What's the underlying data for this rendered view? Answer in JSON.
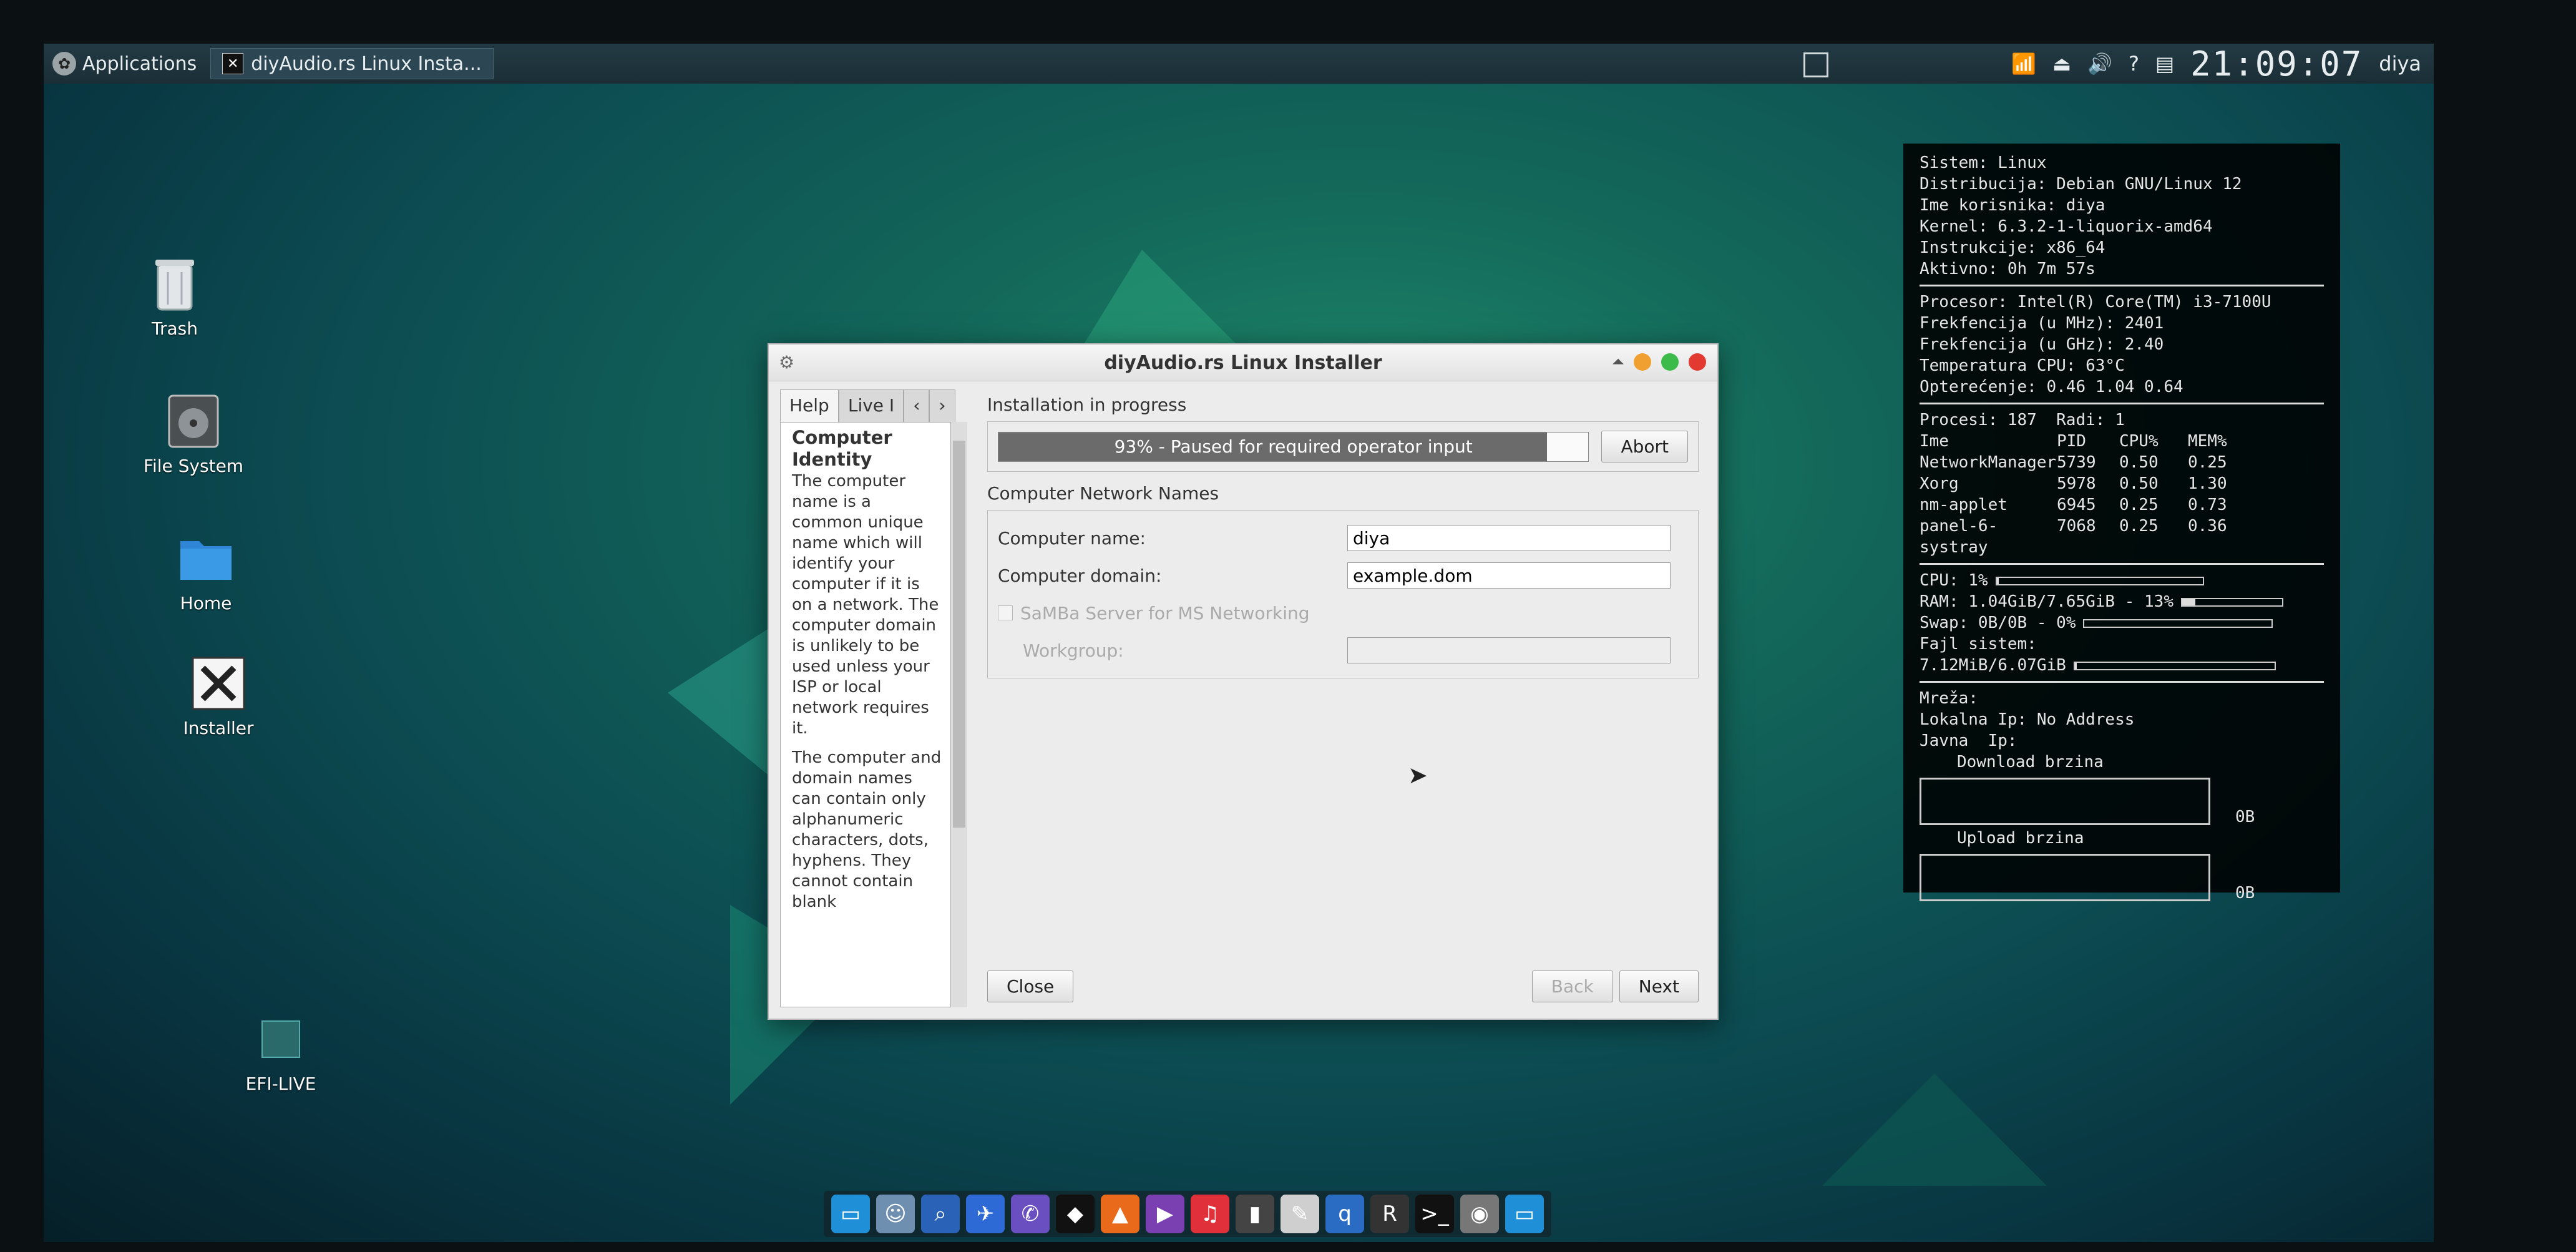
{
  "top_panel": {
    "applications_label": "Applications",
    "task_title": "diyAudio.rs Linux Insta...",
    "clock": "21:09:07",
    "user": "diya"
  },
  "desktop_icons": {
    "trash": "Trash",
    "file_system": "File System",
    "home": "Home",
    "installer": "Installer",
    "efi_live": "EFI-LIVE"
  },
  "conky": {
    "sistem": "Sistem: Linux",
    "distribucija": "Distribucija: Debian GNU/Linux 12",
    "ime_korisnika": "Ime korisnika: diya",
    "kernel": "Kernel: 6.3.2-1-liquorix-amd64",
    "instrukcije": "Instrukcije: x86_64",
    "aktivno": "Aktivno: 0h 7m 57s",
    "procesor": "Procesor: Intel(R) Core(TM) i3-7100U",
    "frek_mhz": "Frekfencija (u MHz): 2401",
    "frek_ghz": "Frekfencija (u GHz): 2.40",
    "temperatura": "Temperatura CPU: 63°C",
    "opterecenje": "Opterećenje: 0.46 1.04 0.64",
    "procesi": "Procesi: 187  Radi: 1",
    "table_headers": [
      "Ime",
      "PID",
      "CPU%",
      "MEM%"
    ],
    "table_rows": [
      [
        "NetworkManager",
        "5739",
        "0.50",
        "0.25"
      ],
      [
        "Xorg",
        "5978",
        "0.50",
        "1.30"
      ],
      [
        "nm-applet",
        "6945",
        "0.25",
        "0.73"
      ],
      [
        "panel-6-systray",
        "7068",
        "0.25",
        "0.36"
      ]
    ],
    "cpu": "CPU: 1%",
    "cpu_fraction": 0.01,
    "ram": "RAM: 1.04GiB/7.65GiB - 13%",
    "ram_fraction": 0.13,
    "swap": "Swap: 0B/0B - 0%",
    "swap_fraction": 0,
    "fajl_sistem_label": "Fajl sistem:",
    "fajl_sistem": "7.12MiB/6.07GiB",
    "fs_fraction": 0.01,
    "mreza": "Mreža:",
    "lokalna_ip": "Lokalna Ip: No Address",
    "javna_ip": "Javna  Ip:",
    "download": "Download brzina",
    "download_value": "0B",
    "upload": "Upload brzina",
    "upload_value": "0B"
  },
  "installer": {
    "title": "diyAudio.rs Linux Installer",
    "tab_help": "Help",
    "tab_live": "Live I",
    "help_heading": "Computer Identity",
    "help_p1": "The computer name is a common unique name which will identify your computer if it is on a network. The computer domain is unlikely to be used unless your ISP or local network requires it.",
    "help_p2": "The computer and domain names can contain only alphanumeric characters, dots, hyphens. They cannot contain blank",
    "progress_group": "Installation in progress",
    "progress_text": "93% - Paused for required operator input",
    "progress_fraction": 0.93,
    "abort_label": "Abort",
    "network_group": "Computer Network Names",
    "computer_name_label": "Computer name:",
    "computer_name_value": "diya",
    "computer_domain_label": "Computer domain:",
    "computer_domain_value": "example.dom",
    "samba_label": "SaMBa Server for MS Networking",
    "workgroup_label": "Workgroup:",
    "workgroup_value": "",
    "close_label": "Close",
    "back_label": "Back",
    "next_label": "Next"
  },
  "dock": {
    "icons": [
      "folder-icon",
      "finder-icon",
      "search-icon",
      "browser-icon",
      "viber-icon",
      "tidal-icon",
      "vlc-icon",
      "player-icon",
      "music-icon",
      "ipod-icon",
      "editor-icon",
      "qbittorrent-icon",
      "rtc-icon",
      "terminal-icon",
      "disk-icon",
      "files-icon"
    ]
  }
}
